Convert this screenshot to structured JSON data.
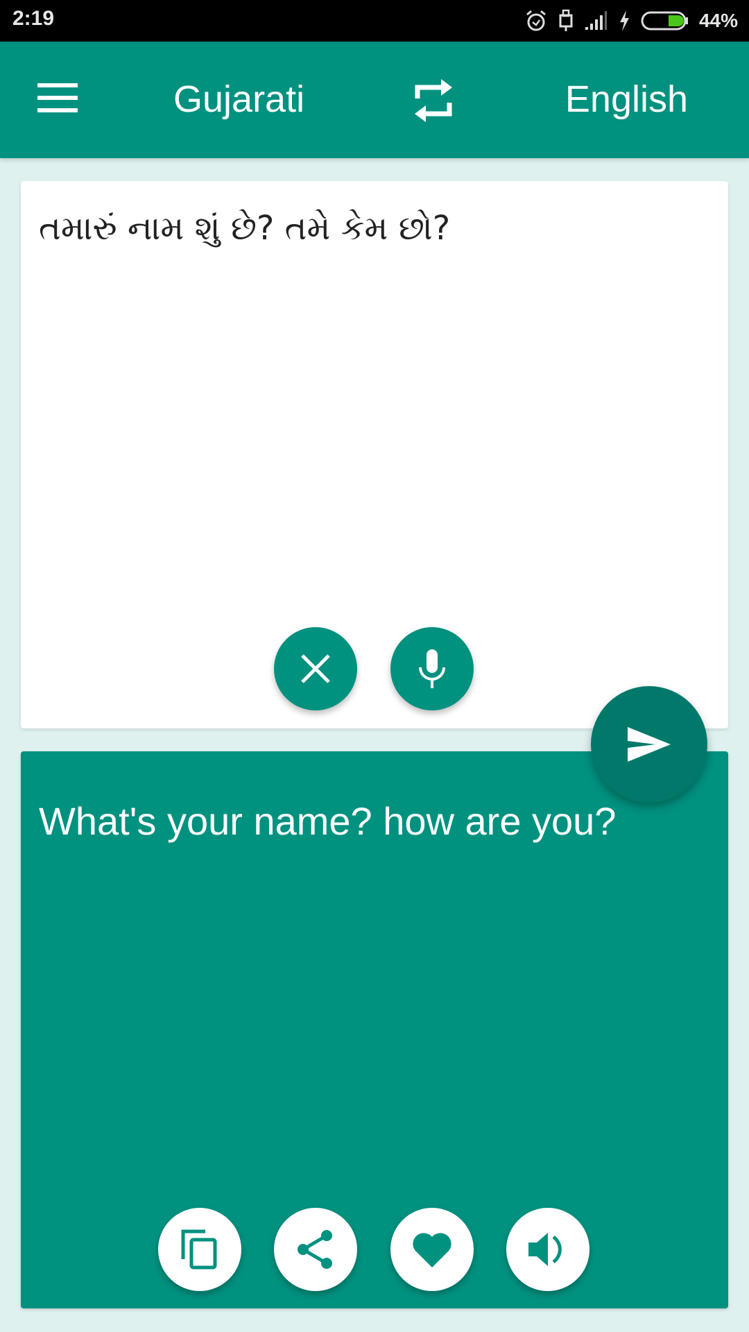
{
  "status_bar": {
    "time": "2:19",
    "battery_percent": "44%",
    "battery_level": 0.44,
    "icons": [
      "alarm-icon",
      "usb-icon",
      "signal-icon",
      "charging-icon",
      "battery-icon"
    ]
  },
  "toolbar": {
    "menu_icon": "menu-icon",
    "source_language": "Gujarati",
    "swap_icon": "swap-icon",
    "target_language": "English"
  },
  "input_card": {
    "text": "તમારું નામ શું છે? તમે કેમ છો?",
    "buttons": [
      {
        "name": "clear",
        "icon": "close-icon"
      },
      {
        "name": "voice",
        "icon": "microphone-icon"
      }
    ]
  },
  "translate_button": {
    "icon": "send-icon"
  },
  "output_card": {
    "text": "What's your name? how are you?",
    "buttons": [
      {
        "name": "copy",
        "icon": "copy-icon"
      },
      {
        "name": "share",
        "icon": "share-icon"
      },
      {
        "name": "favorite",
        "icon": "heart-icon"
      },
      {
        "name": "speak",
        "icon": "speaker-icon"
      }
    ]
  },
  "colors": {
    "primary": "#00917f",
    "primary_dark": "#00796b",
    "background": "#dff1ef"
  }
}
